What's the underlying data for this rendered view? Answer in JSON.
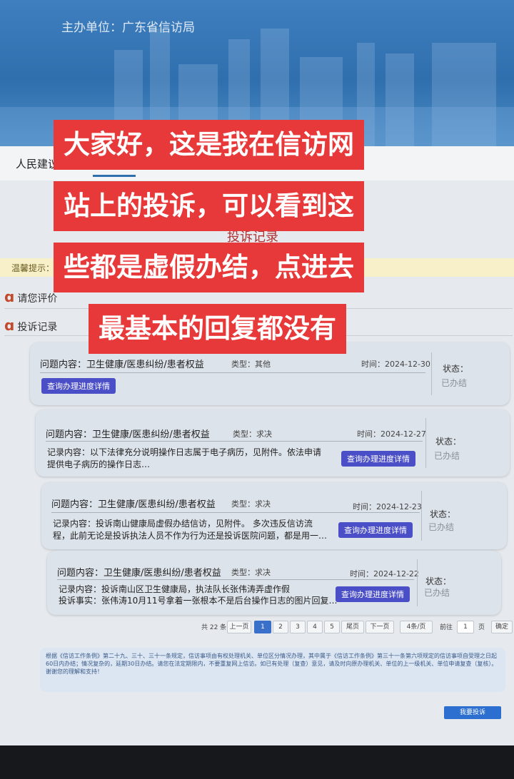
{
  "header": {
    "host": "主办单位：广东省信访局"
  },
  "nav": {
    "tab_label": "人民建议"
  },
  "page": {
    "record_title": "投诉记录",
    "tip": "温馨提示：",
    "rate_section": "请您评价",
    "record_section": "投诉记录"
  },
  "records": [
    {
      "topic": "问题内容：卫生健康/医患纠纷/患者权益",
      "type": "类型：其他",
      "time": "时间：2024-12-30",
      "content1": "",
      "content2": "",
      "button": "查询办理进度详情",
      "status_label": "状态：",
      "status_value": "已办结"
    },
    {
      "topic": "问题内容：卫生健康/医患纠纷/患者权益",
      "type": "类型：求决",
      "time": "时间：2024-12-27",
      "content1": "记录内容：以下法律充分说明操作日志属于电子病历，见附件。依法申请",
      "content2": "提供电子病历的操作日志…",
      "button": "查询办理进度详情",
      "status_label": "状态：",
      "status_value": "已办结"
    },
    {
      "topic": "问题内容：卫生健康/医患纠纷/患者权益",
      "type": "类型：求决",
      "time": "时间：2024-12-23",
      "content1": "记录内容：投诉南山健康局虚假办结信访，见附件。 多次违反信访流",
      "content2": "程，此前无论是投诉执法人员不作为行为还是投诉医院问题，都是用一…",
      "button": "查询办理进度详情",
      "status_label": "状态：",
      "status_value": "已办结"
    },
    {
      "topic": "问题内容：卫生健康/医患纠纷/患者权益",
      "type": "类型：求决",
      "time": "时间：2024-12-22",
      "content1": "记录内容：投诉南山区卫生健康局，执法队长张伟涛弄虚作假",
      "content2": "投诉事实：张伟涛10月11号拿着一张根本不是后台操作日志的图片回复…",
      "button": "查询办理进度详情",
      "status_label": "状态：",
      "status_value": "已办结"
    }
  ],
  "pagination": {
    "total": "共 22 条",
    "prev": "上一页",
    "pages": [
      "1",
      "2",
      "3",
      "4",
      "5"
    ],
    "last": "尾页",
    "next": "下一页",
    "per_page": "4条/页",
    "goto": "前往",
    "goto_value": "1",
    "page_unit": "页",
    "confirm": "确定"
  },
  "notice": {
    "text": "根据《信访工作条例》第二十九、三十、三十一条规定，信访事项由有权处理机关、单位区分情况办理，其中属于《信访工作条例》第三十一条第六项规定的信访事项自受理之日起60日内办结；情况复杂的，延期30日办结。请您在法定期限内，不要重复网上信访。如已有处理（复查）意见，请及时向原办理机关、单位的上一级机关、单位申请复查（复核）。谢谢您的理解和支持！"
  },
  "submit_label": "我要投诉",
  "captions": [
    "大家好，这是我在信访网",
    "站上的投诉，可以看到这",
    "些都是虚假办结，点进去",
    "最基本的回复都没有"
  ],
  "colors": {
    "caption_bg": "#e8393a",
    "button_bg": "#4b4fc7",
    "banner": "#3f7fbf"
  }
}
